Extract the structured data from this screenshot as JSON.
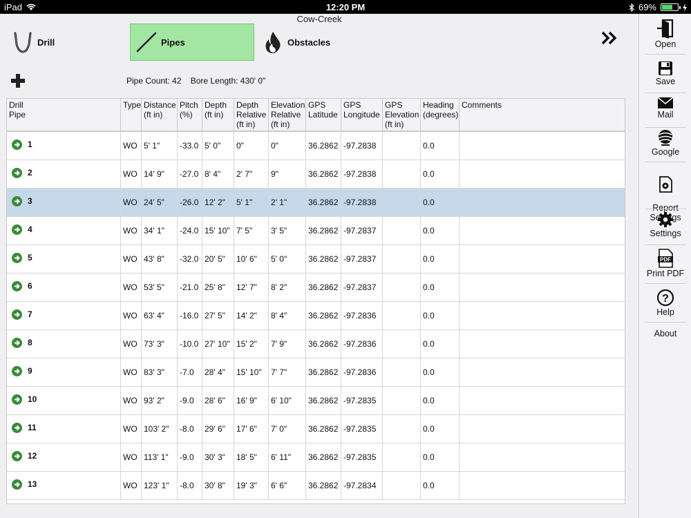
{
  "status": {
    "device": "iPad",
    "time": "12:20 PM",
    "battery": "69%",
    "battery_level": 0.69
  },
  "title": "Cow-Creek",
  "tabs": {
    "drill": "Drill",
    "pipes": "Pipes",
    "obstacles": "Obstacles"
  },
  "info": {
    "pipe_count": "Pipe Count: 42",
    "bore_length": "Bore Length: 430' 0\""
  },
  "columns": [
    "Drill\nPipe",
    "Type",
    "Distance\n(ft in)",
    "Pitch\n(%)",
    "Depth\n(ft in)",
    "Depth\nRelative\n(ft in)",
    "Elevation\nRelative\n(ft in)",
    "GPS\nLatitude",
    "GPS\nLongitude",
    "GPS\nElevation\n(ft in)",
    "Heading\n(degrees)",
    "Comments"
  ],
  "rows": [
    [
      "1",
      "WO",
      "5' 1\"",
      "-33.0",
      "5' 0\"",
      "0\"",
      "0\"",
      "36.2862",
      "-97.2838",
      "",
      "0.0",
      ""
    ],
    [
      "2",
      "WO",
      "14' 9\"",
      "-27.0",
      "8' 4\"",
      "2' 7\"",
      "9\"",
      "36.2862",
      "-97.2838",
      "",
      "0.0",
      ""
    ],
    [
      "3",
      "WO",
      "24' 5\"",
      "-26.0",
      "12' 2\"",
      "5' 1\"",
      "2' 1\"",
      "36.2862",
      "-97.2838",
      "",
      "0.0",
      ""
    ],
    [
      "4",
      "WO",
      "34' 1\"",
      "-24.0",
      "15' 10\"",
      "7' 5\"",
      "3' 5\"",
      "36.2862",
      "-97.2837",
      "",
      "0.0",
      ""
    ],
    [
      "5",
      "WO",
      "43' 8\"",
      "-32.0",
      "20' 5\"",
      "10' 6\"",
      "5' 0\"",
      "36.2862",
      "-97.2837",
      "",
      "0.0",
      ""
    ],
    [
      "6",
      "WO",
      "53' 5\"",
      "-21.0",
      "25' 8\"",
      "12' 7\"",
      "8' 2\"",
      "36.2862",
      "-97.2837",
      "",
      "0.0",
      ""
    ],
    [
      "7",
      "WO",
      "63' 4\"",
      "-16.0",
      "27' 5\"",
      "14' 2\"",
      "8' 4\"",
      "36.2862",
      "-97.2836",
      "",
      "0.0",
      ""
    ],
    [
      "8",
      "WO",
      "73' 3\"",
      "-10.0",
      "27' 10\"",
      "15' 2\"",
      "7' 9\"",
      "36.2862",
      "-97.2836",
      "",
      "0.0",
      ""
    ],
    [
      "9",
      "WO",
      "83' 3\"",
      "-7.0",
      "28' 4\"",
      "15' 10\"",
      "7' 7\"",
      "36.2862",
      "-97.2836",
      "",
      "0.0",
      ""
    ],
    [
      "10",
      "WO",
      "93' 2\"",
      "-9.0",
      "28' 6\"",
      "16' 9\"",
      "6' 10\"",
      "36.2862",
      "-97.2835",
      "",
      "0.0",
      ""
    ],
    [
      "11",
      "WO",
      "103' 2\"",
      "-8.0",
      "29' 6\"",
      "17' 6\"",
      "7' 0\"",
      "36.2862",
      "-97.2835",
      "",
      "0.0",
      ""
    ],
    [
      "12",
      "WO",
      "113' 1\"",
      "-9.0",
      "30' 3\"",
      "18' 5\"",
      "6' 11\"",
      "36.2862",
      "-97.2835",
      "",
      "0.0",
      ""
    ],
    [
      "13",
      "WO",
      "123' 1\"",
      "-8.0",
      "30' 8\"",
      "19' 3\"",
      "6' 6\"",
      "36.2862",
      "-97.2834",
      "",
      "0.0",
      ""
    ]
  ],
  "selected_row": 2,
  "sidebar": {
    "open": "Open",
    "save": "Save",
    "mail": "Mail",
    "google": "Google",
    "report_settings": "Report\nSettings",
    "settings": "Settings",
    "print_pdf": "Print PDF",
    "help": "Help",
    "about": "About",
    "pdf_badge": "PDF",
    "help_glyph": "?"
  },
  "colors": {
    "active_tab": "#a3e5a3",
    "selected_row": "#c6d9eb",
    "arrow": "#3a8a3a"
  },
  "icons": {
    "drill": "drill-pipe-icon",
    "pipes": "pipe-line-icon",
    "obstacles": "flame-icon",
    "chevron": "double-chevron-right-icon",
    "add": "plus-icon",
    "row": "arrow-right-circle-icon"
  }
}
